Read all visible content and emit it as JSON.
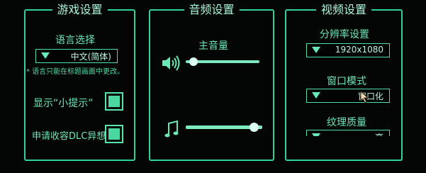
{
  "game_panel": {
    "title": "游戏设置",
    "language_label": "语言选择",
    "language_value": "中文(简体)",
    "language_note": "* 语言只能在标题画面中更改。",
    "show_hints_label": "显示“小提示”",
    "show_hints_checked": true,
    "dlc_label": "申请收容DLC异想体",
    "dlc_checked": true
  },
  "audio_panel": {
    "title": "音频设置",
    "master_volume_label": "主音量",
    "master_volume_level": 0.05,
    "music_volume_level": 0.95
  },
  "video_panel": {
    "title": "视频设置",
    "resolution_label": "分辨率设置",
    "resolution_value": "1920x1080",
    "window_mode_label": "窗口模式",
    "window_mode_value": "窗口化",
    "texture_quality_label": "纹理质量",
    "texture_quality_value": "高"
  },
  "colors": {
    "accent": "#2fd39a",
    "text": "#6ce8b6",
    "background": "#040606"
  }
}
